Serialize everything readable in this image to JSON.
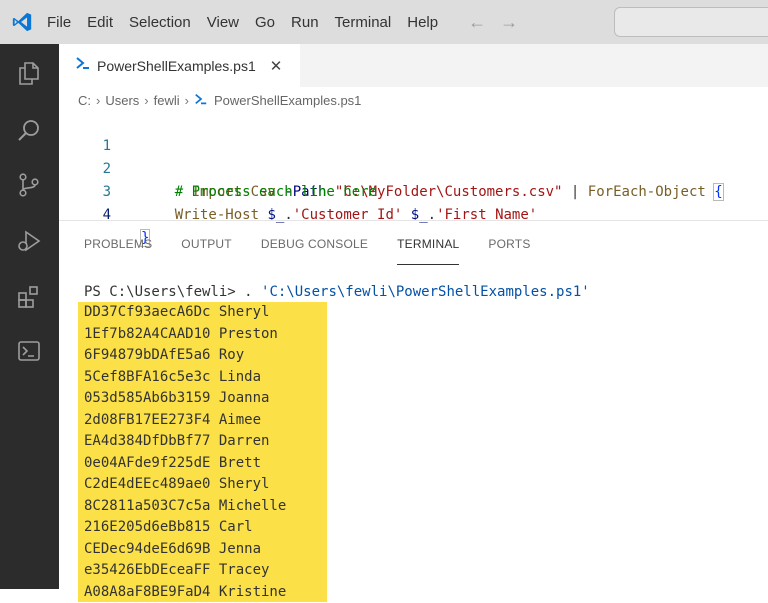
{
  "titlebar": {
    "menu": [
      "File",
      "Edit",
      "Selection",
      "View",
      "Go",
      "Run",
      "Terminal",
      "Help"
    ],
    "nav_back": "←",
    "nav_forward": "→"
  },
  "activity_icons": [
    "explorer-icon",
    "search-icon",
    "source-control-icon",
    "run-debug-icon",
    "extensions-icon",
    "terminal-icon"
  ],
  "tab": {
    "label": "PowerShellExamples.ps1",
    "close": "✕"
  },
  "breadcrumb": [
    "C:",
    "Users",
    "fewli",
    "PowerShellExamples.ps1"
  ],
  "editor": {
    "line_numbers": [
      "1",
      "2",
      "3",
      "4"
    ],
    "line1": {
      "cmd": "Import-Csv",
      "param": "-Path",
      "path": "\"C:\\MyFolder\\Customers.csv\"",
      "pipe": "|",
      "foreach": "ForEach-Object",
      "brace": "{"
    },
    "line2": {
      "comment": "# Process each line here"
    },
    "line3": {
      "cmd": "Write-Host",
      "var1": "$_",
      "dot1": ".",
      "str1": "'Customer Id'",
      "var2": "$_",
      "dot2": ".",
      "str2": "'First Name'"
    },
    "line4": {
      "brace": "}"
    }
  },
  "panel": {
    "tabs": [
      "PROBLEMS",
      "OUTPUT",
      "DEBUG CONSOLE",
      "TERMINAL",
      "PORTS"
    ],
    "active_tab": "TERMINAL"
  },
  "terminal": {
    "prompt": "PS C:\\Users\\fewli> . ",
    "script_path": "'C:\\Users\\fewli\\PowerShellExamples.ps1'",
    "output": [
      "DD37Cf93aecA6Dc Sheryl",
      "1Ef7b82A4CAAD10 Preston",
      "6F94879bDAfE5a6 Roy",
      "5Cef8BFA16c5e3c Linda",
      "053d585Ab6b3159 Joanna",
      "2d08FB17EE273F4 Aimee",
      "EA4d384DfDbBf77 Darren",
      "0e04AFde9f225dE Brett",
      "C2dE4dEEc489ae0 Sheryl",
      "8C2811a503C7c5a Michelle",
      "216E205d6eBb815 Carl",
      "CEDec94deE6d69B Jenna",
      "e35426EbDEceaFF Tracey",
      "A08A8aF8BE9FaD4 Kristine"
    ]
  },
  "colors": {
    "highlight": "#fbe047",
    "activity_bar": "#2c2c2c",
    "titlebar": "#dddddd",
    "vscode_blue": "#0a76d6"
  }
}
